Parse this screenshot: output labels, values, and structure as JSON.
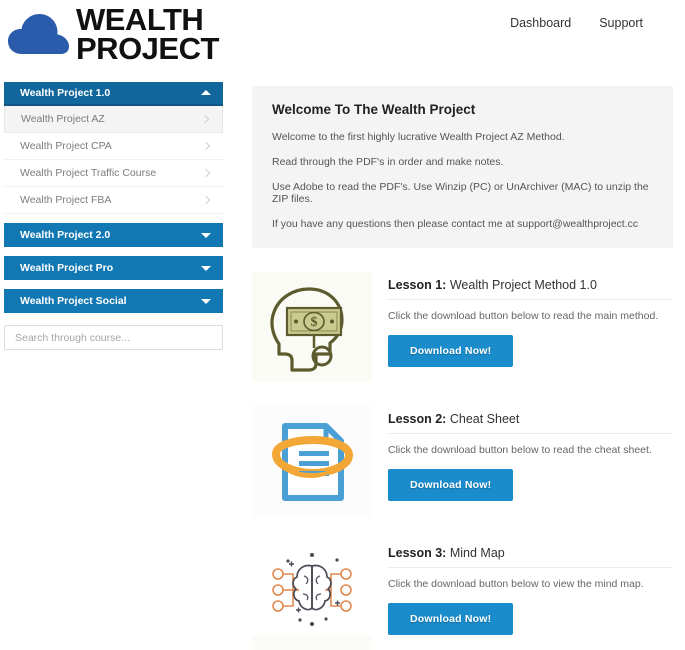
{
  "brand": {
    "line1": "WEALTH",
    "line2": "PROJECT",
    "logo_icon": "cloud-icon",
    "logo_color": "#2a5cab"
  },
  "top_nav": {
    "items": [
      {
        "label": "Dashboard"
      },
      {
        "label": "Support"
      }
    ]
  },
  "sidebar": {
    "courses": [
      {
        "label": "Wealth Project 1.0",
        "expanded": true,
        "caret_icon": "caret-up-icon",
        "items": [
          {
            "label": "Wealth Project AZ",
            "active": true,
            "chevron_icon": "chevron-right-icon"
          },
          {
            "label": "Wealth Project CPA",
            "active": false,
            "chevron_icon": "chevron-right-icon"
          },
          {
            "label": "Wealth Project Traffic Course",
            "active": false,
            "chevron_icon": "chevron-right-icon"
          },
          {
            "label": "Wealth Project FBA",
            "active": false,
            "chevron_icon": "chevron-right-icon"
          }
        ]
      },
      {
        "label": "Wealth Project 2.0",
        "expanded": false,
        "caret_icon": "caret-down-icon",
        "items": []
      },
      {
        "label": "Wealth Project Pro",
        "expanded": false,
        "caret_icon": "caret-down-icon",
        "items": []
      },
      {
        "label": "Wealth Project Social",
        "expanded": false,
        "caret_icon": "caret-down-icon",
        "items": []
      }
    ],
    "search": {
      "placeholder": "Search through course...",
      "value": ""
    },
    "header_color": "#1278b3",
    "header_active_color": "#11679c"
  },
  "welcome": {
    "title": "Welcome To The Wealth Project",
    "paragraphs": [
      "Welcome to the first highly lucrative Wealth Project AZ Method.",
      "Read through the PDF's in order and make notes.",
      "Use Adobe to read the PDF's. Use Winzip (PC) or UnArchiver (MAC) to unzip the ZIP files.",
      "If you have any questions then please contact me at support@wealthproject.cc"
    ]
  },
  "lessons": [
    {
      "label": "Lesson 1:",
      "name": "Wealth Project Method 1.0",
      "description": "Click the download button below to read the main method.",
      "button_label": "Download Now!",
      "thumb_icon": "head-with-money-icon"
    },
    {
      "label": "Lesson 2:",
      "name": "Cheat Sheet",
      "description": "Click the download button below to read the cheat sheet.",
      "button_label": "Download Now!",
      "thumb_icon": "document-swoosh-icon"
    },
    {
      "label": "Lesson 3:",
      "name": "Mind Map",
      "description": "Click the download button below to view the mind map.",
      "button_label": "Download Now!",
      "thumb_icon": "brain-circuit-icon"
    }
  ],
  "colors": {
    "button_blue": "#1b8ccb",
    "sidebar_blue": "#1278b3",
    "panel_gray": "#f4f4f4"
  }
}
